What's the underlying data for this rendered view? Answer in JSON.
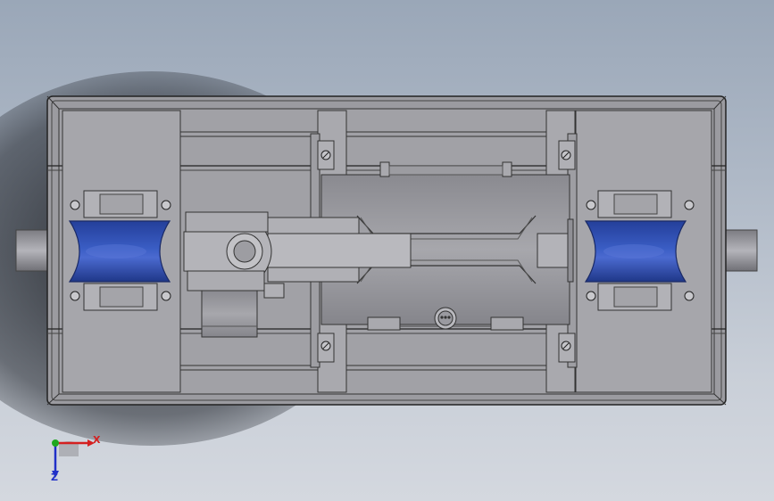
{
  "viewport": {
    "background_top": "#9aa7b8",
    "background_bottom": "#d4d8df"
  },
  "model": {
    "body_color": "#9b9ba0",
    "panel_color": "#a4a4a9",
    "edge_color": "#2a2a30",
    "roller_color": "#2e4fb4",
    "roller_highlight": "#5b78d6"
  },
  "triad": {
    "x_label": "X",
    "z_label": "Z",
    "x_color": "#d42020",
    "y_color": "#1ea81e",
    "z_color": "#2030c8"
  }
}
